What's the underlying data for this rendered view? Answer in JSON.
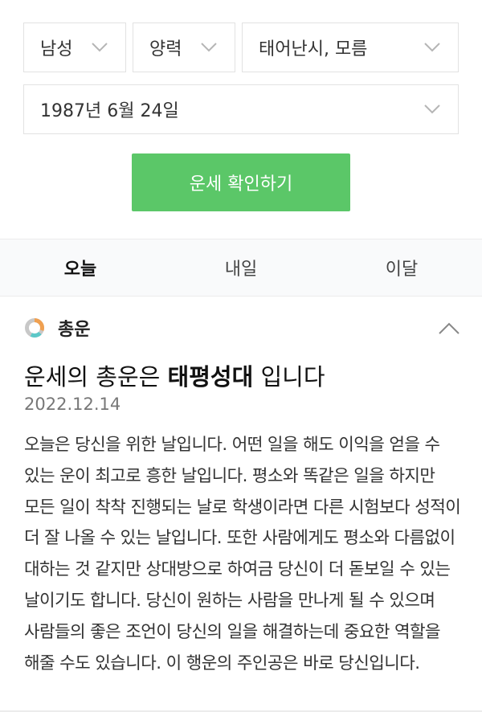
{
  "form": {
    "gender": "남성",
    "calendar": "양력",
    "birth_time": "태어난시, 모름",
    "birth_date": "1987년 6월 24일",
    "submit_label": "운세 확인하기"
  },
  "tabs": [
    {
      "label": "오늘",
      "active": true
    },
    {
      "label": "내일",
      "active": false
    },
    {
      "label": "이달",
      "active": false
    }
  ],
  "fortune": {
    "section_title": "총운",
    "headline_prefix": "운세의 총운은 ",
    "headline_emphasis": "태평성대",
    "headline_suffix": " 입니다",
    "date": "2022.12.14",
    "body": "오늘은 당신을 위한 날입니다. 어떤 일을 해도 이익을 얻을 수 있는 운이 최고로 흥한 날입니다. 평소와 똑같은 일을 하지만 모든 일이 착착 진행되는 날로 학생이라면 다른 시험보다 성적이 더 잘 나올 수 있는 날입니다. 또한 사람에게도 평소와 다름없이 대하는 것 같지만 상대방으로 하여금 당신이 더 돋보일 수 있는 날이기도 합니다. 당신이 원하는 사람을 만나게 될 수 있으며 사람들의 좋은 조언이 당신의 일을 해결하는데 중요한 역할을 해줄 수도 있습니다. 이 행운의 주인공은 바로 당신입니다."
  },
  "colors": {
    "accent_green": "#5bc768",
    "icon_gray": "#c8c8c8",
    "icon_orange": "#f0a050",
    "icon_teal": "#5cc8c8"
  },
  "icons": {
    "dropdown": "chevron-down-icon",
    "collapse": "chevron-up-icon",
    "section": "donut-icon"
  }
}
